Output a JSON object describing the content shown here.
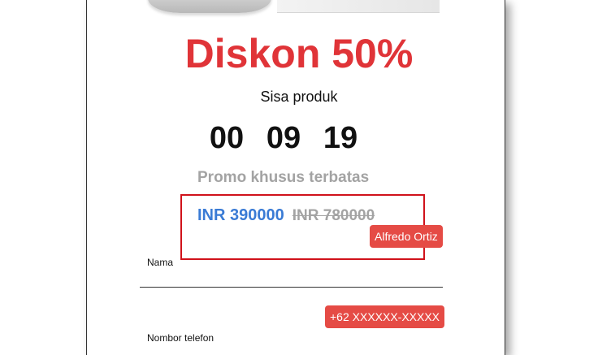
{
  "promo": {
    "headline": "Diskon 50%",
    "stock_label": "Sisa produk",
    "countdown": {
      "hours": "00",
      "minutes": "09",
      "seconds": "19"
    },
    "promo_label": "Promo khusus terbatas",
    "price_new": "INR 390000",
    "price_old": "INR 780000"
  },
  "form": {
    "name_value": "Alfredo Ortiz",
    "name_label": "Nama",
    "phone_value": "+62 XXXXXX-XXXXX",
    "phone_label": "Nombor telefon"
  },
  "colors": {
    "accent_red": "#e03438",
    "price_blue": "#3a7bd5",
    "chip_red": "#e54b45",
    "highlight_border": "#d0121b"
  }
}
